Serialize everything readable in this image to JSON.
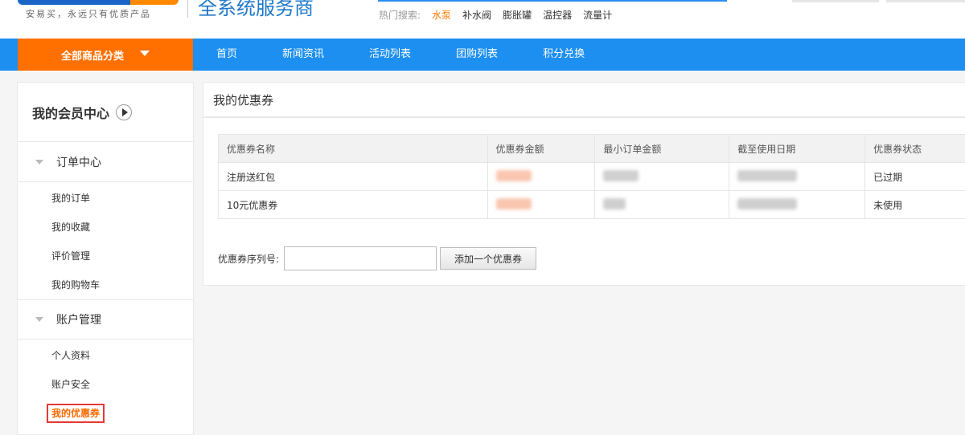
{
  "header": {
    "slogan": "安易买，永远只有优质产品",
    "brand": "全系统服务商",
    "hot_search": {
      "label": "热门搜索:",
      "keywords": [
        "水泵",
        "补水阀",
        "膨胀罐",
        "温控器",
        "流量计"
      ],
      "highlight_color": "#ff7a00"
    }
  },
  "nav": {
    "category_label": "全部商品分类",
    "items": [
      "首页",
      "新闻资讯",
      "活动列表",
      "团购列表",
      "积分兑换"
    ],
    "bar_color": "#1c8ff0",
    "category_color": "#ff7000"
  },
  "sidebar": {
    "title": "我的会员中心",
    "groups": [
      {
        "label": "订单中心",
        "items": [
          "我的订单",
          "我的收藏",
          "评价管理",
          "我的购物车"
        ]
      },
      {
        "label": "账户管理",
        "items": [
          "个人资料",
          "账户安全",
          "我的优惠券"
        ]
      }
    ],
    "active_item": "我的优惠券"
  },
  "main": {
    "title": "我的优惠券",
    "table": {
      "headers": [
        "优惠券名称",
        "优惠券金额",
        "最小订单金额",
        "截至使用日期",
        "优惠券状态"
      ],
      "rows": [
        {
          "name": "注册送红包",
          "status": "已过期"
        },
        {
          "name": "10元优惠券",
          "status": "未使用"
        }
      ]
    },
    "serial_label": "优惠券序列号:",
    "serial_value": "",
    "add_button": "添加一个优惠券"
  }
}
